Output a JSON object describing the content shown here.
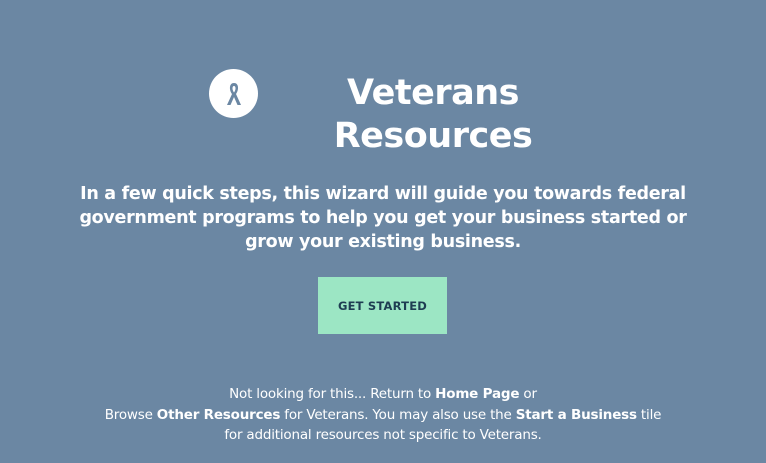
{
  "page": {
    "icon": "ribbon-icon",
    "title_line1": "Veterans",
    "title_line2": "Resources",
    "intro": "In a few quick steps, this wizard will guide you towards federal government programs to help you get your business started or grow your existing business.",
    "cta_label": "GET STARTED"
  },
  "footer": {
    "line1_prefix": "Not looking for this... Return to ",
    "home_link": "Home Page",
    "line1_suffix": " or",
    "line2_prefix": "Browse ",
    "other_link": "Other Resources",
    "line2_middle": " for Veterans. You may also use the ",
    "start_link": "Start a Business",
    "line2_suffix": " tile",
    "line3": "for additional resources not specific to Veterans."
  },
  "colors": {
    "background": "#6b87a3",
    "button_bg": "#9ce6c4",
    "button_text": "#1e3d52",
    "text": "#ffffff"
  }
}
